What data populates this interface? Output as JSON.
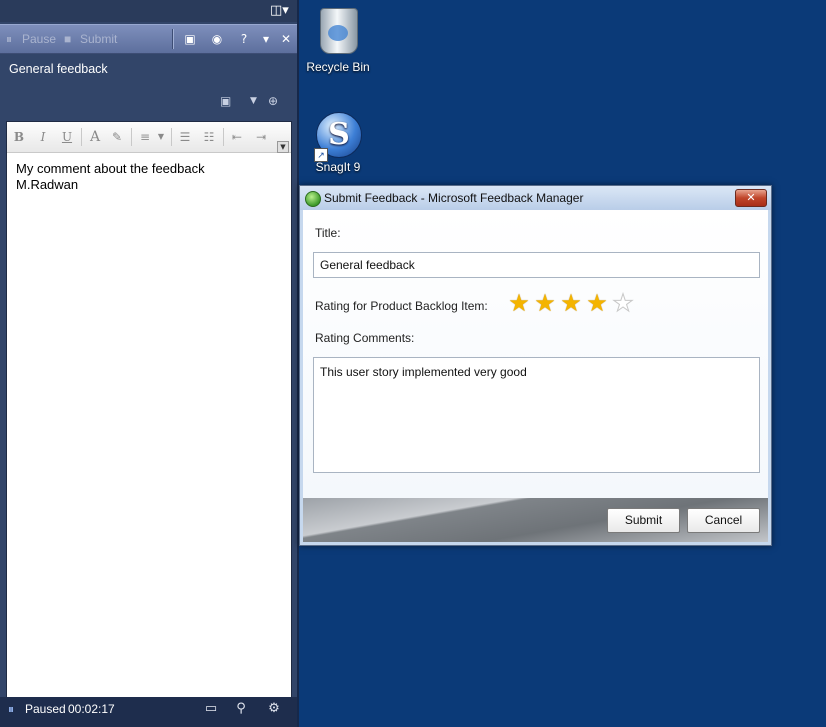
{
  "panel": {
    "toolbar": {
      "pause_label": "Pause",
      "submit_label": "Submit"
    },
    "feedback_title": "General feedback",
    "editor_text": "My comment about the feedback\nM.Radwan",
    "status": {
      "state": "Paused",
      "time": "00:02:17"
    }
  },
  "desktop": {
    "icons": [
      {
        "label": "Recycle Bin",
        "icon": "recycle-bin-icon"
      },
      {
        "label": "SnagIt 9",
        "icon": "snagit-icon"
      }
    ]
  },
  "dialog": {
    "title": "Submit Feedback - Microsoft Feedback Manager",
    "close_label": "✕",
    "title_label": "Title:",
    "title_value": "General feedback",
    "rating_label": "Rating for Product Backlog Item:",
    "rating": 4,
    "rating_max": 5,
    "comments_label": "Rating Comments:",
    "comments_value": "This user story implemented very good",
    "submit_label": "Submit",
    "cancel_label": "Cancel"
  },
  "colors": {
    "desktop_bg": "#0b3a78",
    "panel_bg": "#324569",
    "star_on": "#f4b400"
  }
}
